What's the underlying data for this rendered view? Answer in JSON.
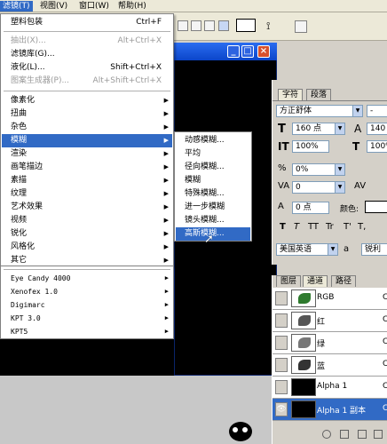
{
  "menubar": {
    "items": [
      {
        "label": "滤镜(T)",
        "active": true
      },
      {
        "label": "视图(V)",
        "active": false
      },
      {
        "label": "窗口(W)",
        "active": false
      },
      {
        "label": "帮助(H)",
        "active": false
      }
    ]
  },
  "filter_menu": {
    "last_filter": {
      "label": "塑料包装",
      "shortcut": "Ctrl+F"
    },
    "extract": {
      "label": "抽出(X)...",
      "shortcut": "Alt+Ctrl+X"
    },
    "gallery": {
      "label": "滤镜库(G)..."
    },
    "liquify": {
      "label": "液化(L)...",
      "shortcut": "Shift+Ctrl+X"
    },
    "pattern": {
      "label": "图案生成器(P)...",
      "shortcut": "Alt+Shift+Ctrl+X"
    },
    "groups": [
      "像素化",
      "扭曲",
      "杂色",
      "模糊",
      "渲染",
      "画笔描边",
      "素描",
      "纹理",
      "艺术效果",
      "视频",
      "锐化",
      "风格化",
      "其它"
    ],
    "plugins": [
      "Eye Candy 4000",
      "Xenofex 1.0",
      "Digimarc",
      "KPT 3.0",
      "KPT5"
    ],
    "highlighted": "模糊"
  },
  "blur_submenu": {
    "items": [
      "动感模糊...",
      "平均",
      "径向模糊...",
      "模糊",
      "特殊模糊...",
      "进一步模糊",
      "镜头模糊...",
      "高斯模糊..."
    ],
    "highlighted": "高斯模糊..."
  },
  "character_panel": {
    "tabs": [
      "字符",
      "段落"
    ],
    "font_family": "方正舒体",
    "font_style": "-",
    "font_size": "160 点",
    "leading": "140",
    "vertical_scale": "100%",
    "horizontal_scale": "100%",
    "tracking": "0%",
    "kerning": "0",
    "baseline": "0 点",
    "color_label": "颜色:",
    "style_buttons": [
      "T",
      "T",
      "TT",
      "Tr",
      "T'",
      "T,"
    ],
    "language": "美国英语",
    "aa_label": "a",
    "aa_value": "锐利"
  },
  "channels_panel": {
    "tabs": [
      "图层",
      "通道",
      "路径"
    ],
    "channels": [
      {
        "name": "RGB",
        "key": "C"
      },
      {
        "name": "红",
        "key": "C"
      },
      {
        "name": "绿",
        "key": "C"
      },
      {
        "name": "蓝",
        "key": "C"
      },
      {
        "name": "Alpha 1",
        "key": "C"
      },
      {
        "name": "Alpha 1 副本",
        "key": "C",
        "selected": true
      }
    ]
  },
  "window_buttons": {
    "minimize": "_",
    "maximize": "□",
    "close": "×"
  }
}
